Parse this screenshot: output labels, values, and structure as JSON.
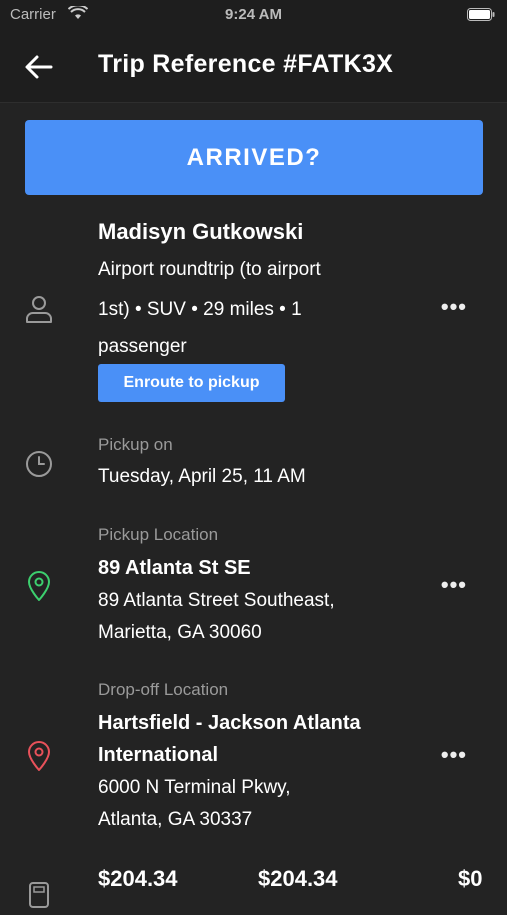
{
  "status_bar": {
    "carrier": "Carrier",
    "time": "9:24 AM"
  },
  "nav": {
    "title": "Trip Reference #FATK3X"
  },
  "arrived_button": {
    "label": "ARRIVED?"
  },
  "passenger": {
    "name": "Madisyn Gutkowski",
    "trip_line1": "Airport roundtrip (to airport",
    "trip_line2": "1st) • SUV • 29 miles • 1",
    "trip_line3": "passenger",
    "status_chip": "Enroute to pickup"
  },
  "pickup_time": {
    "label": "Pickup on",
    "value": "Tuesday, April 25, 11 AM"
  },
  "pickup_location": {
    "label": "Pickup Location",
    "name": "89 Atlanta St SE",
    "address_line1": "89 Atlanta Street Southeast,",
    "address_line2": "Marietta, GA 30060"
  },
  "dropoff_location": {
    "label": "Drop-off Location",
    "name_line1": "Hartsfield - Jackson Atlanta",
    "name_line2": "International",
    "address_line1": "6000 N Terminal Pkwy,",
    "address_line2": "Atlanta, GA 30337"
  },
  "fares": {
    "amount1": "$204.34",
    "amount2": "$204.34",
    "amount3": "$0"
  },
  "more_label": "•••",
  "colors": {
    "accent": "#4a90f7",
    "pickup_pin": "#3ccf6e",
    "dropoff_pin": "#e8515a",
    "background": "#232323"
  }
}
